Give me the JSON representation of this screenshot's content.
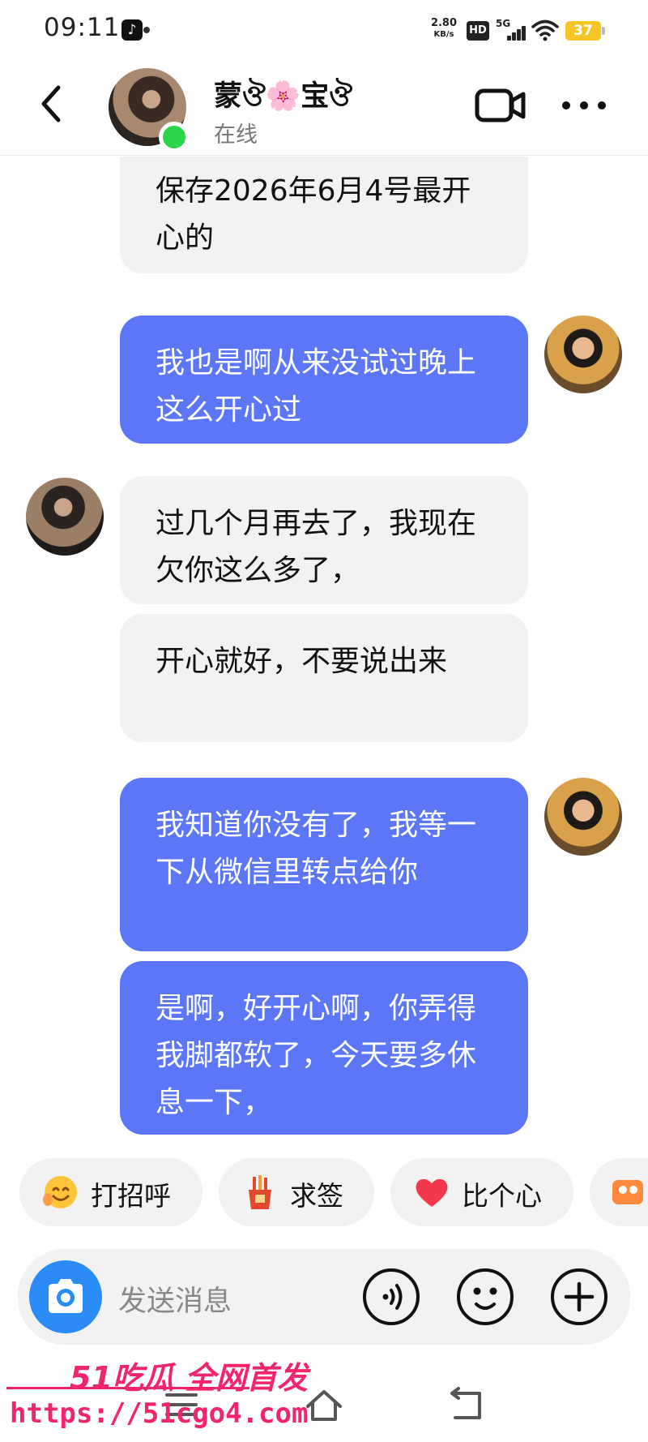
{
  "status_bar": {
    "time": "09:11",
    "net_speed": "2.80",
    "net_speed_unit": "KB/s",
    "hd_label": "HD",
    "network_label": "5G",
    "battery": "37"
  },
  "header": {
    "contact_name": "蒙ঔ🌸宝ঔ",
    "presence": "在线",
    "online_color": "#2bd448"
  },
  "messages": [
    {
      "side": "in",
      "text": "保存2026年6月4号最开心的"
    },
    {
      "side": "out",
      "text": "我也是啊从来没试过晚上这么开心过"
    },
    {
      "side": "in",
      "text": "过几个月再去了，我现在欠你这么多了，"
    },
    {
      "side": "in",
      "text": "开心就好，不要说出来"
    },
    {
      "side": "out",
      "text": "我知道你没有了，我等一下从微信里转点给你"
    },
    {
      "side": "out",
      "text": "是啊，好开心啊，你弄得我脚都软了，今天要多休息一下，"
    }
  ],
  "quick_replies": [
    {
      "label": "打招呼",
      "icon": "smiley-wave-icon"
    },
    {
      "label": "求签",
      "icon": "fortune-sticks-icon"
    },
    {
      "label": "比个心",
      "icon": "heart-icon"
    }
  ],
  "input": {
    "placeholder": "发送消息"
  },
  "watermark": {
    "logo": "51吃瓜 全网首发",
    "url": "https://51cgo4.com"
  },
  "colors": {
    "outgoing_bubble": "#5b76f7",
    "incoming_bubble": "#f2f2f2",
    "accent_camera": "#2a8af6",
    "battery": "#f5c528"
  }
}
